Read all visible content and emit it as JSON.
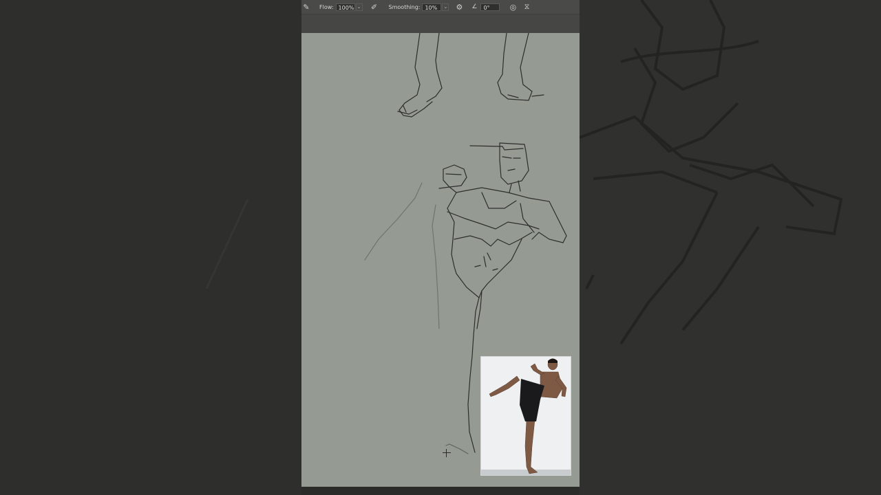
{
  "toolbar": {
    "flow_label": "Flow:",
    "flow_value": "100%",
    "smoothing_label": "Smoothing:",
    "smoothing_value": "10%",
    "angle_value": "0°",
    "icons": [
      "brush-icon",
      "airbrush-icon",
      "gear-icon",
      "angle-icon",
      "pressure-icon",
      "symmetry-icon"
    ]
  },
  "colors": {
    "canvas": "#959a93",
    "toolbar": "#4a4b48",
    "background": "#2e2f2c",
    "sketch_line": "#2c2e2b"
  }
}
